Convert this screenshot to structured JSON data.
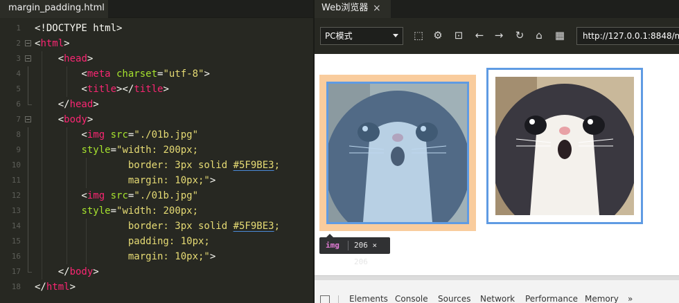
{
  "editor": {
    "tab_title": "margin_padding.html",
    "lines": [
      {
        "num": "1",
        "segments": [
          {
            "t": "<!DOCTYPE html>",
            "c": "c-punc"
          }
        ]
      },
      {
        "num": "2",
        "segments": [
          {
            "t": "<",
            "c": "c-punc"
          },
          {
            "t": "html",
            "c": "c-tag"
          },
          {
            "t": ">",
            "c": "c-punc"
          }
        ]
      },
      {
        "num": "3",
        "segments": [
          {
            "t": "    <",
            "c": "c-punc"
          },
          {
            "t": "head",
            "c": "c-tag"
          },
          {
            "t": ">",
            "c": "c-punc"
          }
        ]
      },
      {
        "num": "4",
        "segments": [
          {
            "t": "        <",
            "c": "c-punc"
          },
          {
            "t": "meta",
            "c": "c-tag"
          },
          {
            "t": " charset",
            "c": "c-attr"
          },
          {
            "t": "=",
            "c": "c-punc"
          },
          {
            "t": "\"utf-8\"",
            "c": "c-str"
          },
          {
            "t": ">",
            "c": "c-punc"
          }
        ]
      },
      {
        "num": "5",
        "segments": [
          {
            "t": "        <",
            "c": "c-punc"
          },
          {
            "t": "title",
            "c": "c-tag"
          },
          {
            "t": "></",
            "c": "c-punc"
          },
          {
            "t": "title",
            "c": "c-tag"
          },
          {
            "t": ">",
            "c": "c-punc"
          }
        ]
      },
      {
        "num": "6",
        "segments": [
          {
            "t": "    </",
            "c": "c-punc"
          },
          {
            "t": "head",
            "c": "c-tag"
          },
          {
            "t": ">",
            "c": "c-punc"
          }
        ]
      },
      {
        "num": "7",
        "segments": [
          {
            "t": "    <",
            "c": "c-punc"
          },
          {
            "t": "body",
            "c": "c-tag"
          },
          {
            "t": ">",
            "c": "c-punc"
          }
        ]
      },
      {
        "num": "8",
        "segments": [
          {
            "t": "        <",
            "c": "c-punc"
          },
          {
            "t": "img",
            "c": "c-tag"
          },
          {
            "t": " src",
            "c": "c-attr"
          },
          {
            "t": "=",
            "c": "c-punc"
          },
          {
            "t": "\"./01b.jpg\"",
            "c": "c-str"
          }
        ]
      },
      {
        "num": "9",
        "segments": [
          {
            "t": "        ",
            "c": "c-plain"
          },
          {
            "t": "style",
            "c": "c-attr"
          },
          {
            "t": "=",
            "c": "c-punc"
          },
          {
            "t": "\"width: 200px;",
            "c": "c-str"
          }
        ]
      },
      {
        "num": "10",
        "segments": [
          {
            "t": "                border: 3px solid ",
            "c": "c-str"
          },
          {
            "t": "#5F9BE3",
            "c": "c-str c-under"
          },
          {
            "t": ";",
            "c": "c-str"
          }
        ]
      },
      {
        "num": "11",
        "segments": [
          {
            "t": "                margin: 10px;\"",
            "c": "c-str"
          },
          {
            "t": ">",
            "c": "c-punc"
          }
        ]
      },
      {
        "num": "12",
        "segments": [
          {
            "t": "        <",
            "c": "c-punc"
          },
          {
            "t": "img",
            "c": "c-tag"
          },
          {
            "t": " src",
            "c": "c-attr"
          },
          {
            "t": "=",
            "c": "c-punc"
          },
          {
            "t": "\"./01b.jpg\"",
            "c": "c-str"
          }
        ]
      },
      {
        "num": "13",
        "segments": [
          {
            "t": "        ",
            "c": "c-plain"
          },
          {
            "t": "style",
            "c": "c-attr"
          },
          {
            "t": "=",
            "c": "c-punc"
          },
          {
            "t": "\"width: 200px;",
            "c": "c-str"
          }
        ]
      },
      {
        "num": "14",
        "segments": [
          {
            "t": "                border: 3px solid ",
            "c": "c-str"
          },
          {
            "t": "#5F9BE3",
            "c": "c-str c-under"
          },
          {
            "t": ";",
            "c": "c-str"
          }
        ]
      },
      {
        "num": "15",
        "segments": [
          {
            "t": "                padding: 10px;",
            "c": "c-str"
          }
        ]
      },
      {
        "num": "16",
        "segments": [
          {
            "t": "                margin: 10px;\"",
            "c": "c-str"
          },
          {
            "t": ">",
            "c": "c-punc"
          }
        ]
      },
      {
        "num": "17",
        "segments": [
          {
            "t": "    </",
            "c": "c-punc"
          },
          {
            "t": "body",
            "c": "c-tag"
          },
          {
            "t": ">",
            "c": "c-punc"
          }
        ]
      },
      {
        "num": "18",
        "segments": [
          {
            "t": "</",
            "c": "c-punc"
          },
          {
            "t": "html",
            "c": "c-tag"
          },
          {
            "t": ">",
            "c": "c-punc"
          }
        ]
      }
    ]
  },
  "browser": {
    "tab_title": "Web浏览器",
    "tab_close": "×",
    "mode_label": "PC模式",
    "url": "http://127.0.0.1:8848/my",
    "icons": [
      "screenshot-icon",
      "settings-icon",
      "console-icon",
      "back-icon",
      "forward-icon",
      "reload-icon",
      "lock-icon",
      "qrcode-icon"
    ],
    "icon_glyphs": [
      "⬚",
      "⚙",
      "⊡",
      "←",
      "→",
      "↻",
      "⌂",
      "▦"
    ],
    "highlight": {
      "tag": "img",
      "size": "206 × 206"
    },
    "border_color": "#5F9BE3",
    "margin_color": "#f9cc9d",
    "devtools_tabs": [
      "Elements",
      "Console",
      "Sources",
      "Network",
      "Performance",
      "Memory",
      "»"
    ]
  }
}
